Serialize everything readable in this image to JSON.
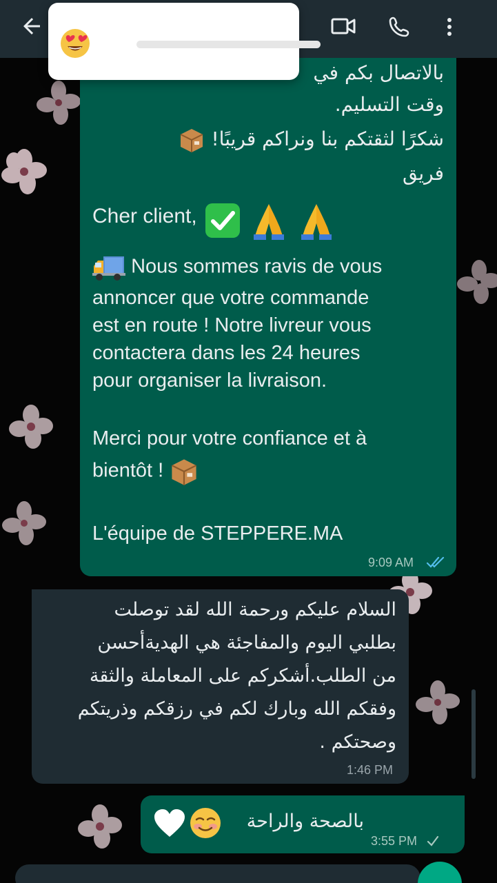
{
  "header": {
    "back_icon": "arrow-left-icon",
    "video_icon": "video-call-icon",
    "call_icon": "phone-icon",
    "menu_icon": "more-vertical-icon"
  },
  "reaction_popup": {
    "emoji": "heart-eyes-emoji",
    "bar_color": "#e6e6e6"
  },
  "messages": {
    "outgoing_1": {
      "ar_line1": "بالاتصال بكم في",
      "ar_line2": "وقت التسليم.",
      "ar_line3": "شكرًا لثقتكم بنا ونراكم قريبًا!",
      "ar_line4": "فريق",
      "fr_greeting": "Cher client,",
      "fr_p1_l1": "Nous sommes ravis de vous",
      "fr_p1_l2": "annoncer que votre commande",
      "fr_p1_l3": "est en route ! Notre livreur vous",
      "fr_p1_l4": "contactera dans les 24 heures",
      "fr_p1_l5": "pour organiser la livraison.",
      "fr_p2_l1": "Merci pour votre confiance et à",
      "fr_p2_l2": "bientôt !",
      "fr_sign": "L'équipe de STEPPERE.MA",
      "time": "9:09 AM",
      "status": "read"
    },
    "incoming_1": {
      "line1": "السلام عليكم ورحمة الله لقد توصلت",
      "line2": "بطلبي اليوم والمفاجئة هي الهديةأحسن",
      "line3": "من الطلب.أشكركم على المعاملة والثقة",
      "line4": "وفقكم الله وبارك لكم في رزقكم وذريتكم",
      "line5": "وصحتكم .",
      "time": "1:46 PM"
    },
    "outgoing_2": {
      "text": "بالصحة والراحة",
      "time": "3:55 PM",
      "status": "sent"
    }
  },
  "colors": {
    "outgoing_bubble": "#005c4b",
    "incoming_bubble": "#1f2c33",
    "header": "#1f2c33",
    "read_ticks": "#53bdeb",
    "accent": "#00a884"
  }
}
